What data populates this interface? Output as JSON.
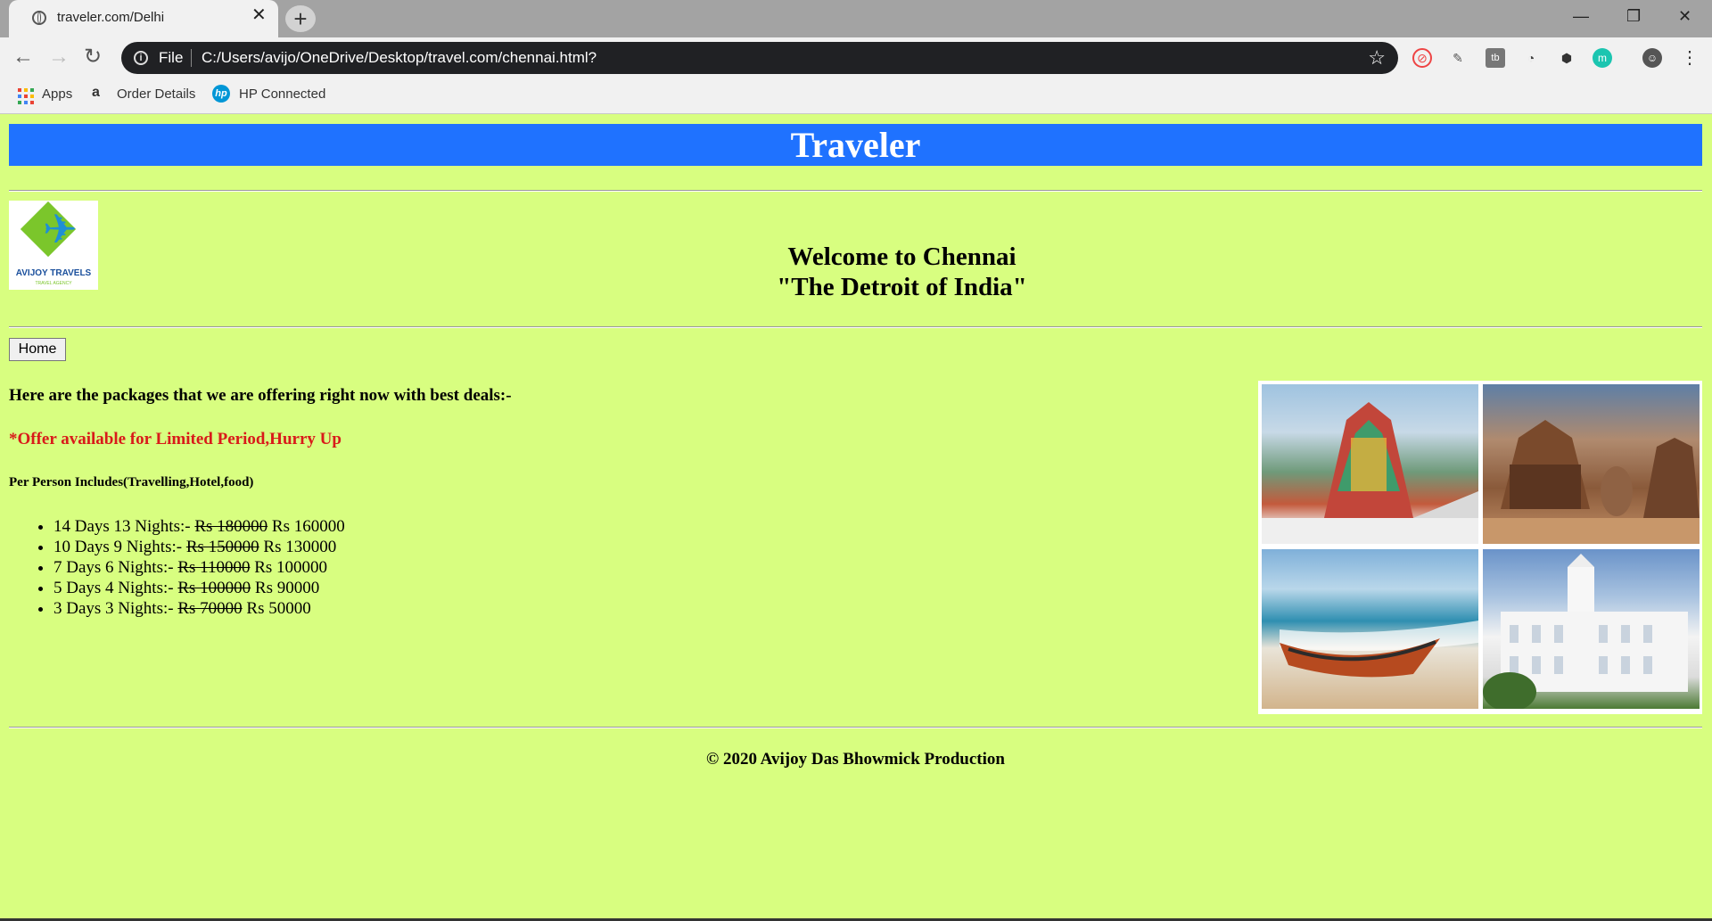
{
  "browser": {
    "tab_title": "traveler.com/Delhi",
    "new_tab_label": "+",
    "url_scheme_label": "File",
    "url": "C:/Users/avijo/OneDrive/Desktop/travel.com/chennai.html?",
    "bookmarks": [
      "Apps",
      "Order Details",
      "HP Connected"
    ]
  },
  "page": {
    "banner_title": "Traveler",
    "logo_text": "AVIJOY TRAVELS",
    "logo_subtext": "TRAVEL AGENCY",
    "welcome_line1": "Welcome to Chennai",
    "welcome_line2": "\"The Detroit of India\"",
    "home_button": "Home",
    "intro": "Here are the packages that we are offering right now with best deals:-",
    "offer": "*Offer available for Limited Period,Hurry Up",
    "includes": "Per Person Includes(Travelling,Hotel,food)",
    "packages": [
      {
        "duration": "14 Days 13 Nights:-",
        "old_price": "Rs 180000",
        "new_price": "Rs 160000"
      },
      {
        "duration": "10 Days 9 Nights:-",
        "old_price": "Rs 150000",
        "new_price": "Rs 130000"
      },
      {
        "duration": "7 Days 6 Nights:-",
        "old_price": "Rs 110000",
        "new_price": "Rs 100000"
      },
      {
        "duration": "5 Days 4 Nights:-",
        "old_price": "Rs 100000",
        "new_price": "Rs 90000"
      },
      {
        "duration": "3 Days 3 Nights:-",
        "old_price": "Rs 70000",
        "new_price": "Rs 50000"
      }
    ],
    "footer": "© 2020 Avijoy Das Bhowmick Production"
  },
  "colors": {
    "page_background": "#d8fe80",
    "banner": "#1f72ff",
    "offer_text": "#d91a1a"
  },
  "icons": [
    "globe-icon",
    "close-icon",
    "back-arrow-icon",
    "forward-arrow-icon",
    "reload-icon",
    "info-icon",
    "star-icon",
    "apps-grid-icon",
    "amazon-icon",
    "hp-icon",
    "menu-dots-icon",
    "profile-icon"
  ]
}
